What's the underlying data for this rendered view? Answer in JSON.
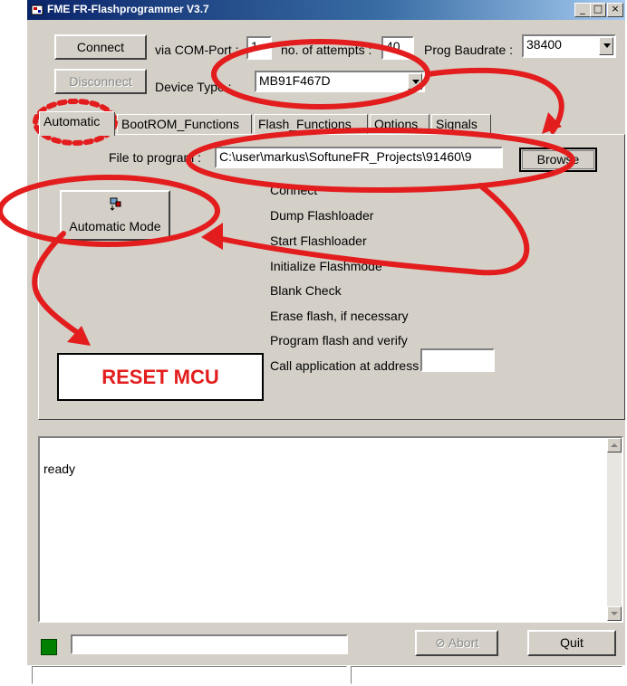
{
  "window": {
    "title": "FME FR-Flashprogrammer V3.7",
    "minimize": "_",
    "maximize": "□",
    "close": "×"
  },
  "top": {
    "connect_label": "Connect",
    "disconnect_label": "Disconnect",
    "com_port_label": "via COM-Port :",
    "com_port_value": "1",
    "attempts_label": "no. of attempts :",
    "attempts_value": "40",
    "baudrate_label": "Prog Baudrate :",
    "baudrate_value": "38400",
    "device_type_label": "Device Type :",
    "device_type_value": "MB91F467D"
  },
  "tabs": [
    {
      "label": "Automatic"
    },
    {
      "label": "BootROM_Functions"
    },
    {
      "label": "Flash_Functions"
    },
    {
      "label": "Options"
    },
    {
      "label": "Signals"
    }
  ],
  "automatic": {
    "file_label": "File to program :",
    "file_value": "C:\\user\\markus\\SoftuneFR_Projects\\91460\\9",
    "browse_label": "Browse",
    "auto_mode_label": "Automatic Mode",
    "steps": [
      "Connect",
      "Dump Flashloader",
      "Start Flashloader",
      "Initialize Flashmode",
      "Blank Check",
      "Erase flash, if necessary",
      "Program flash and verify",
      "Call application at address"
    ],
    "address_value": ""
  },
  "log": {
    "text": "ready"
  },
  "bottom": {
    "abort_label": "Abort",
    "quit_label": "Quit",
    "progress": 0
  },
  "annotations": {
    "reset_label": "RESET MCU"
  },
  "colors": {
    "annotation_red": "#e31d1d",
    "status_led": "#008000",
    "title_blue": "#0a246a"
  }
}
